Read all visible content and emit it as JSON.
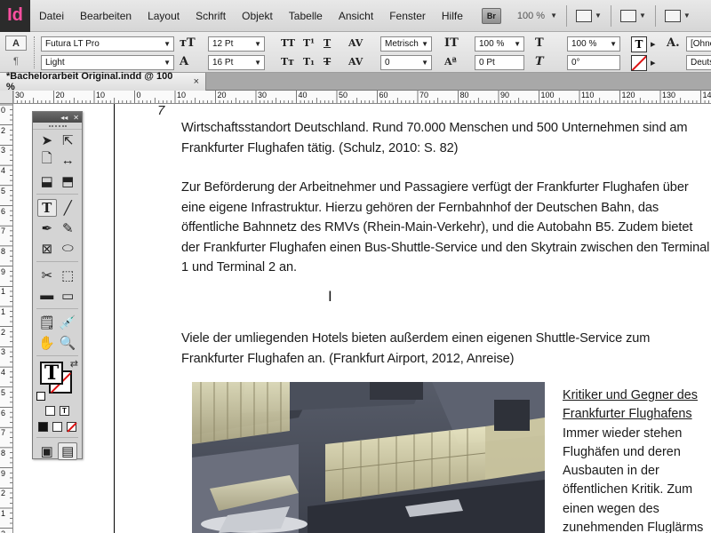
{
  "app": {
    "logo": "Id",
    "menu": [
      "Datei",
      "Bearbeiten",
      "Layout",
      "Schrift",
      "Objekt",
      "Tabelle",
      "Ansicht",
      "Fenster",
      "Hilfe"
    ],
    "bridge_label": "Br",
    "zoom": "100 %"
  },
  "control": {
    "font_family": "Futura LT Pro",
    "font_style": "Light",
    "font_size": "12 Pt",
    "leading": "16 Pt",
    "kerning": "Metrisch",
    "tracking": "0",
    "vertical_scale": "100 %",
    "horizontal_scale": "100 %",
    "baseline_shift": "0 Pt",
    "skew": "0°",
    "style_field_1": "[Ohne",
    "style_field_2": "Deuts"
  },
  "document": {
    "tab_title": "*Bachelorarbeit Original.indd @ 100 %",
    "tab_close": "×",
    "ruler_h": [
      "30",
      "20",
      "10",
      "0",
      "10",
      "20",
      "30",
      "40",
      "50",
      "60",
      "70",
      "80",
      "90",
      "100",
      "110",
      "120",
      "130",
      "140"
    ],
    "ruler_v": [
      "0",
      "2",
      "3",
      "4",
      "5",
      "6",
      "7",
      "8",
      "9",
      "1",
      "1",
      "2",
      "3",
      "4",
      "5",
      "6",
      "7",
      "8",
      "9",
      "2",
      "1",
      "2"
    ],
    "page_number": "7",
    "paragraph_1": "Wirtschaftsstandort Deutschland. Rund 70.000 Menschen und 500 Unternehmen sind am Frankfurter Flughafen tätig. (Schulz, 2010: S. 82)",
    "paragraph_2": "Zur Beförderung der Arbeitnehmer und Passagiere verfügt der Frankfurter Flughafen über eine eigene Infrastruktur. Hierzu gehören der Fernbahnhof der Deutschen Bahn, das öffentliche Bahnnetz des RMVs (Rhein-Main-Verkehr), und die Autobahn B5. Zudem bietet der Frankfurter Flughafen einen Bus-Shuttle-Service und den Skytrain zwischen den Terminal 1 und Terminal 2 an.",
    "paragraph_3": "Viele der umliegenden Hotels bieten außerdem einen eigenen Shuttle-Service zum Frankfurter Flughafen an. (Frankfurt Airport, 2012, Anreise)",
    "sidebar_heading": "Kritiker und Gegner des Frankfurter Flughafens",
    "sidebar_body": "Immer wieder stehen Flughäfen und deren Ausbauten in der öffentlichen Kritik. Zum einen wegen des zunehmenden Fluglärms"
  }
}
